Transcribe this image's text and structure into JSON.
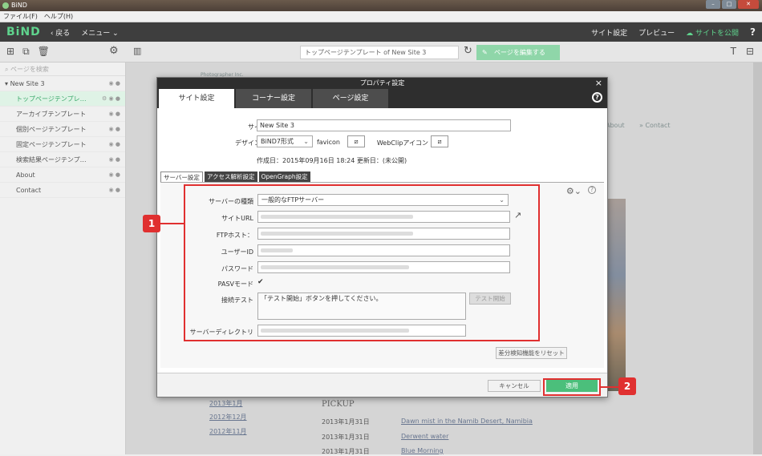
{
  "window": {
    "title": "BiND"
  },
  "menubar": {
    "items": [
      "ファイル(F)",
      "ヘルプ(H)"
    ]
  },
  "appbar": {
    "logo": "BiND",
    "back": "‹ 戻る",
    "menu": "メニュー ⌄",
    "site_settings": "サイト設定",
    "preview": "プレビュー",
    "publish": "サイトを公開",
    "help": "?"
  },
  "toolbar": {
    "page_field": "トップページテンプレート of New Site 3",
    "edit_button": "ページを編集する"
  },
  "sidebar": {
    "search_placeholder": "ページを検索",
    "site": "New Site 3",
    "pages": [
      "トップページテンプレ…",
      "アーカイブテンプレート",
      "個別ページテンプレート",
      "固定ページテンプレート",
      "検索結果ページテンプ…",
      "About",
      "Contact"
    ]
  },
  "canvas": {
    "company": "Photographer Inc.",
    "nav_about": "About",
    "nav_contact": "» Contact",
    "pickup": "PICKUP",
    "archive": [
      "2013年1月",
      "2012年12月",
      "2012年11月"
    ],
    "dates": [
      "2013年1月31日",
      "2013年1月31日",
      "2013年1月31日"
    ],
    "links": [
      "Dawn mist in the Namib Desert, Namibia",
      "Derwent water",
      "Blue Morning"
    ]
  },
  "dialog": {
    "title": "プロパティ設定",
    "close": "×",
    "help": "?",
    "tabs": [
      "サイト設定",
      "コーナー設定",
      "ページ設定"
    ],
    "site_name_label": "サイト名",
    "site_name_value": "New Site 3",
    "design_label": "デザイン形式",
    "design_value": "BiND7形式",
    "favicon_label": "favicon",
    "webclip_label": "WebClipアイコン",
    "created": "作成日：2015年09月16日 18:24 更新日：(未公開)",
    "subtabs": [
      "サーバー設定",
      "アクセス解析設定",
      "OpenGraph設定"
    ],
    "server_type_label": "サーバーの種類",
    "server_type_value": "一般的なFTPサーバー",
    "site_url_label": "サイトURL",
    "ftp_host_label": "FTPホスト：",
    "user_id_label": "ユーザーID",
    "password_label": "パスワード",
    "pasv_label": "PASVモード",
    "pasv_checked": "✔",
    "conn_test_label": "接続テスト",
    "conn_test_message": "「テスト開始」ボタンを押してください。",
    "test_start": "テスト開始",
    "server_dir_label": "サーバーディレクトリ",
    "reset_button": "差分検知機能をリセット",
    "cancel": "キャンセル",
    "apply": "適用"
  },
  "annotations": {
    "marker1": "1",
    "marker2": "2"
  }
}
